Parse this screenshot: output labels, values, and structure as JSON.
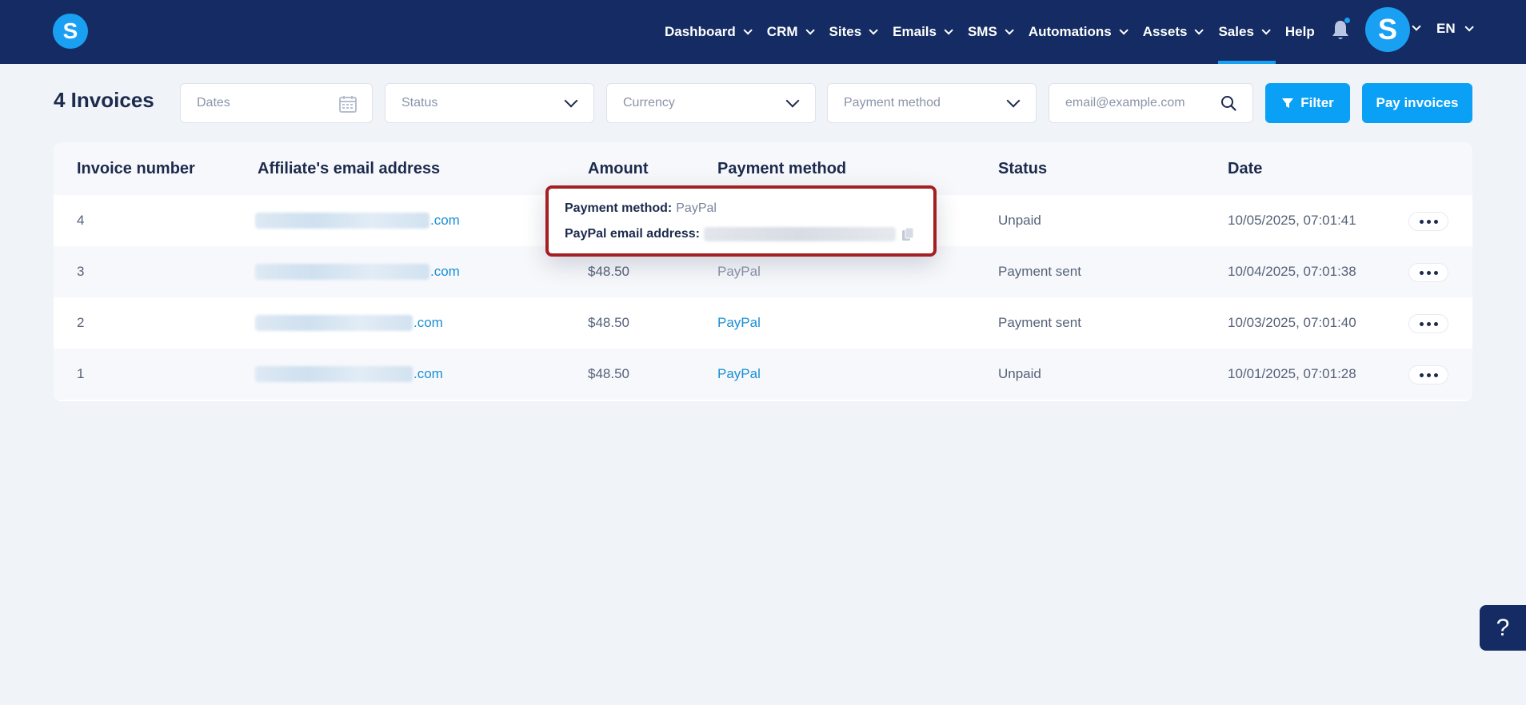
{
  "brand": {
    "logo_letter": "S",
    "avatar_letter": "S"
  },
  "nav": {
    "items": [
      {
        "label": "Dashboard"
      },
      {
        "label": "CRM"
      },
      {
        "label": "Sites"
      },
      {
        "label": "Emails"
      },
      {
        "label": "SMS"
      },
      {
        "label": "Automations"
      },
      {
        "label": "Assets"
      },
      {
        "label": "Sales"
      },
      {
        "label": "Help"
      }
    ],
    "active": "Sales",
    "language": "EN"
  },
  "toolbar": {
    "title": "4 Invoices",
    "dates_placeholder": "Dates",
    "status_placeholder": "Status",
    "currency_placeholder": "Currency",
    "payment_method_placeholder": "Payment method",
    "email_placeholder": "email@example.com",
    "filter_label": "Filter",
    "pay_label": "Pay invoices"
  },
  "table": {
    "headers": [
      "Invoice number",
      "Affiliate's email address",
      "Amount",
      "Payment method",
      "Status",
      "Date"
    ],
    "rows": [
      {
        "number": "4",
        "email_suffix": ".com",
        "amount": "",
        "method": "",
        "status": "Unpaid",
        "date": "10/05/2025, 07:01:41"
      },
      {
        "number": "3",
        "email_suffix": ".com",
        "amount": "$48.50",
        "method": "PayPal",
        "status": "Payment sent",
        "date": "10/04/2025, 07:01:38"
      },
      {
        "number": "2",
        "email_suffix": ".com",
        "amount": "$48.50",
        "method": "PayPal",
        "status": "Payment sent",
        "date": "10/03/2025, 07:01:40"
      },
      {
        "number": "1",
        "email_suffix": ".com",
        "amount": "$48.50",
        "method": "PayPal",
        "status": "Unpaid",
        "date": "10/01/2025, 07:01:28"
      }
    ]
  },
  "tooltip": {
    "method_label": "Payment method:",
    "method_value": "PayPal",
    "email_label": "PayPal email address:"
  },
  "help_fab": "?",
  "colors": {
    "nav_bg": "#142c63",
    "accent": "#0aa0f5",
    "highlight_border": "#a31f24",
    "link": "#1a8fd6"
  }
}
